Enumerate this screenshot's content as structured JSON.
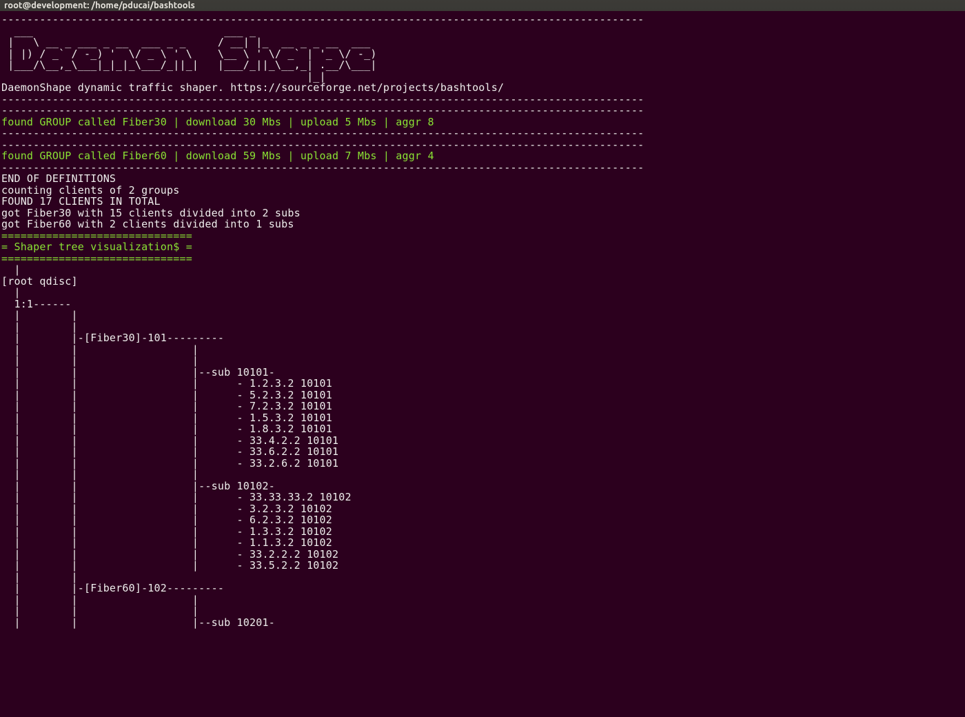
{
  "titlebar": "root@development: /home/pducai/bashtools",
  "sep": "-----------------------------------------------------------------------------------------------------",
  "ascii": {
    "l1": "  ___                              ___ _                    ",
    "l2": " |   \\ __ _ ___ _ __  ___ _ _     / __| |_  __ _ _ __  ___  ",
    "l3": " | |) / _` / -_) '  \\/ _ \\ ' \\    \\__ \\ ' \\/ _` | '_ \\/ -_) ",
    "l4": " |___/\\__,_\\___|_|_|_\\___/_||_|   |___/_||_\\__,_| .__/\\___| ",
    "l5": "                                                |_|         "
  },
  "subtitle": "DaemonShape dynamic traffic shaper. https://sourceforge.net/projects/bashtools/",
  "group1": "found GROUP called Fiber30 | download 30 Mbs | upload 5 Mbs | aggr 8",
  "group2": "found GROUP called Fiber60 | download 59 Mbs | upload 7 Mbs | aggr 4",
  "def_end": "END OF DEFINITIONS",
  "counting": "counting clients of 2 groups",
  "found_clients": "FOUND 17 CLIENTS IN TOTAL",
  "got_f30": "got Fiber30 with 15 clients divided into 2 subs",
  "got_f60": "got Fiber60 with 2 clients divided into 1 subs",
  "eqbar": "==============================",
  "viz_title": "= Shaper tree visualization$ =",
  "tree": {
    "pipe0": "  |",
    "root_q": "[root qdisc]",
    "pipe1": "  |",
    "t11": "  1:1------",
    "c1": "  |        |",
    "c2": "  |        |",
    "fib30": "  |        |-[Fiber30]-101---------",
    "c3": "  |        |                  |",
    "c4": "  |        |                  |",
    "s101": "  |        |                  |--sub 10101-",
    "a1": "  |        |                  |      - 1.2.3.2 10101",
    "a2": "  |        |                  |      - 5.2.3.2 10101",
    "a3": "  |        |                  |      - 7.2.3.2 10101",
    "a4": "  |        |                  |      - 1.5.3.2 10101",
    "a5": "  |        |                  |      - 1.8.3.2 10101",
    "a6": "  |        |                  |      - 33.4.2.2 10101",
    "a7": "  |        |                  |      - 33.6.2.2 10101",
    "a8": "  |        |                  |      - 33.2.6.2 10101",
    "c5": "  |        |                  |",
    "s102": "  |        |                  |--sub 10102-",
    "b1": "  |        |                  |      - 33.33.33.2 10102",
    "b2": "  |        |                  |      - 3.2.3.2 10102",
    "b3": "  |        |                  |      - 6.2.3.2 10102",
    "b4": "  |        |                  |      - 1.3.3.2 10102",
    "b5": "  |        |                  |      - 1.1.3.2 10102",
    "b6": "  |        |                  |      - 33.2.2.2 10102",
    "b7": "  |        |                  |      - 33.5.2.2 10102",
    "c6": "  |        |",
    "fib60": "  |        |-[Fiber60]-102---------",
    "c7": "  |        |                  |",
    "c8": "  |        |                  |",
    "s201": "  |        |                  |--sub 10201-"
  }
}
